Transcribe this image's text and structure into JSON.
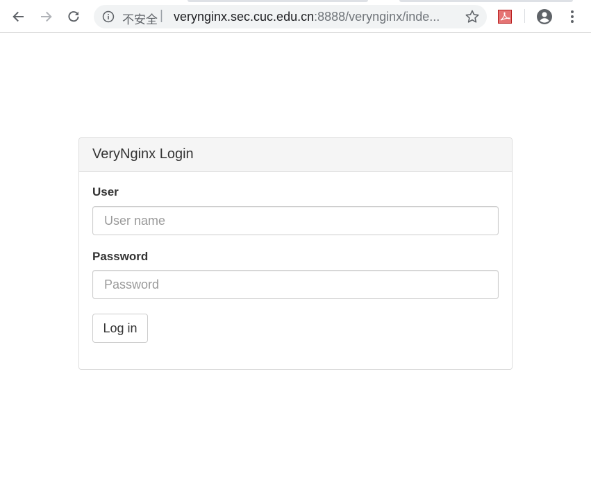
{
  "browser": {
    "security_label": "不安全",
    "separator": "|",
    "url_host": "verynginx.sec.cuc.edu.cn",
    "url_rest": ":8888/verynginx/inde..."
  },
  "icons": {
    "back": "arrow-left-icon",
    "forward": "arrow-right-icon",
    "reload": "reload-icon",
    "info": "info-icon",
    "bookmark": "star-icon",
    "extension": "pdf-extension-icon",
    "account": "account-circle-icon",
    "menu": "kebab-menu-icon"
  },
  "colors": {
    "panel_heading_bg": "#f5f5f5",
    "panel_border": "#dddddd",
    "text": "#333333",
    "placeholder": "#999999",
    "pdf_icon": "#d9534f"
  },
  "login": {
    "title": "VeryNginx Login",
    "user_label": "User",
    "user_placeholder": "User name",
    "password_label": "Password",
    "password_placeholder": "Password",
    "submit_label": "Log in"
  }
}
